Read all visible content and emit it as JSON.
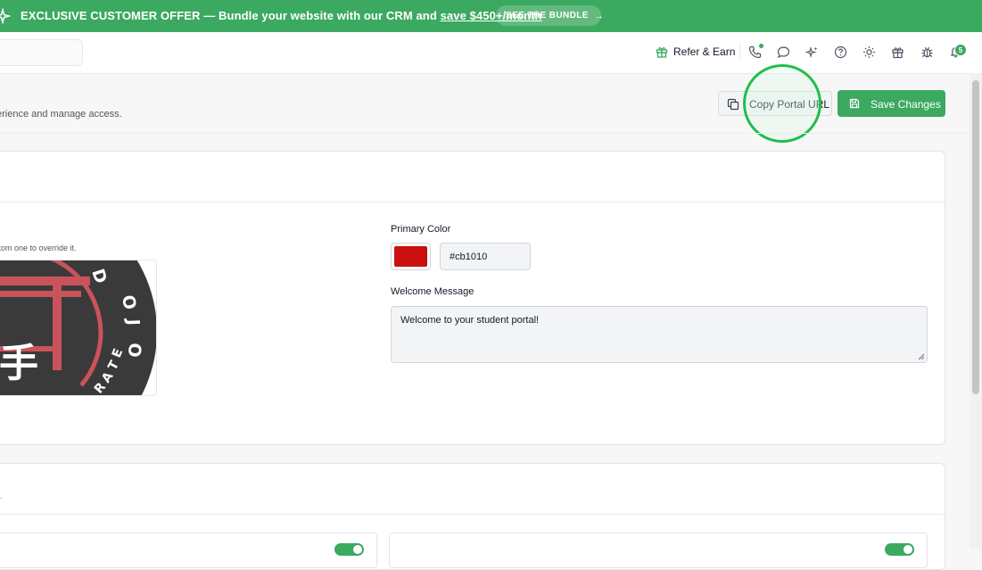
{
  "banner": {
    "text_prefix": "EXCLUSIVE CUSTOMER OFFER — Bundle your website with our CRM and ",
    "save_link": "save $450+/month",
    "bundle_button": "SEE THE BUNDLE"
  },
  "topbar": {
    "refer_label": "Refer & Earn",
    "notification_count": "5",
    "icons": [
      "gift-icon",
      "phone-icon",
      "chat-icon",
      "sparkles-icon",
      "help-icon",
      "sun-icon",
      "gift-icon",
      "bug-icon",
      "bell-icon"
    ]
  },
  "page": {
    "subtitle": "erience and manage access.",
    "copy_button": "Copy Portal URL",
    "save_button": "Save Changes"
  },
  "branding": {
    "logo_hint": "stom one to override it.",
    "primary_color_label": "Primary Color",
    "primary_color_value": "#cb1010",
    "welcome_label": "Welcome Message",
    "welcome_value": "Welcome to your student portal!"
  },
  "second_section": {
    "note": "l."
  },
  "colors": {
    "accent": "#3ca960",
    "primary": "#cb1010",
    "highlight": "#1fbf4a"
  }
}
